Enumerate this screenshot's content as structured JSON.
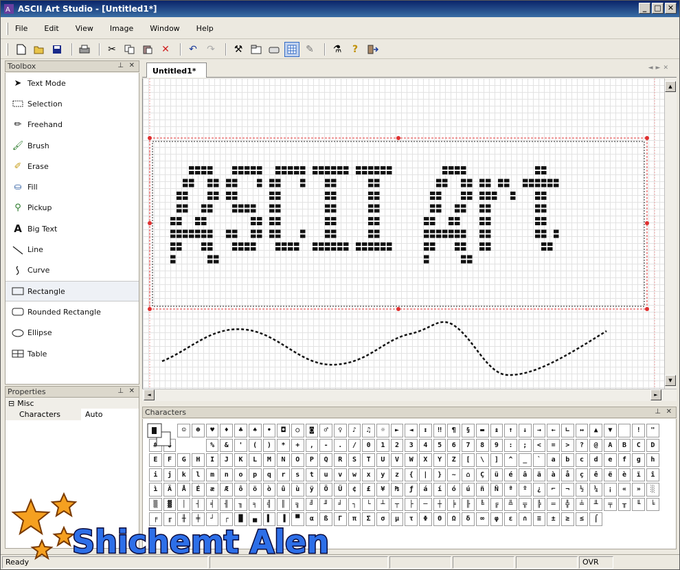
{
  "window": {
    "title": "ASCII Art Studio - [Untitled1*]",
    "buttons": [
      "_",
      "□",
      "✕"
    ]
  },
  "menu": [
    "File",
    "Edit",
    "View",
    "Image",
    "Window",
    "Help"
  ],
  "toolbar": {
    "icons": [
      "new-icon",
      "open-icon",
      "save-icon",
      "print-icon",
      "cut-icon",
      "copy-icon",
      "paste-icon",
      "delete-icon",
      "undo-icon",
      "redo-icon",
      "tools-icon",
      "properties-icon",
      "scanner-icon",
      "grid-icon",
      "pin-icon",
      "wand-icon",
      "help-icon",
      "exit-icon"
    ]
  },
  "toolbox": {
    "title": "Toolbox",
    "items": [
      {
        "label": "Text Mode",
        "icon": "arrow-icon"
      },
      {
        "label": "Selection",
        "icon": "selection-icon"
      },
      {
        "label": "Freehand",
        "icon": "pencil-icon"
      },
      {
        "label": "Brush",
        "icon": "brush-icon"
      },
      {
        "label": "Erase",
        "icon": "eraser-icon"
      },
      {
        "label": "Fill",
        "icon": "bucket-icon"
      },
      {
        "label": "Pickup",
        "icon": "dropper-icon"
      },
      {
        "label": "Big Text",
        "icon": "big-text-icon"
      },
      {
        "label": "Line",
        "icon": "line-icon"
      },
      {
        "label": "Curve",
        "icon": "curve-icon"
      },
      {
        "label": "Rectangle",
        "icon": "rectangle-icon"
      },
      {
        "label": "Rounded Rectangle",
        "icon": "rounded-rectangle-icon"
      },
      {
        "label": "Ellipse",
        "icon": "ellipse-icon"
      },
      {
        "label": "Table",
        "icon": "table-icon"
      }
    ],
    "selected": "Rectangle"
  },
  "properties": {
    "title": "Properties",
    "category": "Misc",
    "rows": [
      {
        "key": "Characters",
        "value": "Auto"
      }
    ]
  },
  "document": {
    "tab": "Untitled1*",
    "art_text": "ASCII Art"
  },
  "characters": {
    "title": "Characters",
    "rows": [
      [
        "",
        "",
        "☺",
        "☻",
        "♥",
        "♦",
        "♣",
        "♠",
        "•",
        "◘",
        "○",
        "◙",
        "♂",
        "♀",
        "♪",
        "♫",
        "☼",
        "►",
        "◄",
        "↕",
        "‼",
        "¶",
        "§",
        "▬",
        "↨",
        "↑",
        "↓",
        "→",
        "←",
        "∟",
        "↔",
        "▲",
        "▼",
        " ",
        "!",
        "\"",
        "#",
        "$"
      ],
      [
        "",
        "",
        "%",
        "&",
        "'",
        "(",
        ")",
        "*",
        "+",
        ",",
        "-",
        ".",
        "/",
        "0",
        "1",
        "2",
        "3",
        "4",
        "5",
        "6",
        "7",
        "8",
        "9",
        ":",
        ";",
        "<",
        "=",
        ">",
        "?",
        "@",
        "A",
        "B",
        "C",
        "D",
        "E"
      ],
      [
        "F",
        "G",
        "H",
        "I",
        "J",
        "K",
        "L",
        "M",
        "N",
        "O",
        "P",
        "Q",
        "R",
        "S",
        "T",
        "U",
        "V",
        "W",
        "X",
        "Y",
        "Z",
        "[",
        "\\",
        "]",
        "^",
        "_",
        "`",
        "a",
        "b",
        "c",
        "d",
        "e",
        "f",
        "g",
        "h"
      ],
      [
        "i",
        "j",
        "k",
        "l",
        "m",
        "n",
        "o",
        "p",
        "q",
        "r",
        "s",
        "t",
        "u",
        "v",
        "w",
        "x",
        "y",
        "z",
        "{",
        "|",
        "}",
        "~",
        "⌂",
        "Ç",
        "ü",
        "é",
        "â",
        "ä",
        "à",
        "å",
        "ç",
        "ê",
        "ë",
        "è",
        "ï"
      ],
      [
        "î",
        "ì",
        "Ä",
        "Å",
        "É",
        "æ",
        "Æ",
        "ô",
        "ö",
        "ò",
        "û",
        "ù",
        "ÿ",
        "Ö",
        "Ü",
        "¢",
        "£",
        "¥",
        "₧",
        "ƒ",
        "á",
        "í",
        "ó",
        "ú",
        "ñ",
        "Ñ",
        "ª",
        "º",
        "¿",
        "⌐",
        "¬",
        "½",
        "¼",
        "¡",
        "«"
      ],
      [
        "»",
        "░",
        "▒",
        "▓",
        "│",
        "┤",
        "╡",
        "╢",
        "╖",
        "╕",
        "╣",
        "║",
        "╗",
        "╝",
        "╜",
        "╛",
        "┐",
        "└",
        "┴",
        "┬",
        "├",
        "─",
        "┼",
        "╞",
        "╟",
        "╚",
        "╔",
        "╩",
        "╦",
        "╠",
        "═",
        "╬",
        "╧",
        "╨",
        "╤"
      ],
      [
        "╥",
        "╙",
        "╘",
        "╒",
        "╓",
        "╫",
        "╪",
        "┘",
        "┌",
        "█",
        "▄",
        "▌",
        "▐",
        "▀",
        "α",
        "ß",
        "Γ",
        "π",
        "Σ",
        "σ",
        "µ",
        "τ",
        "Φ",
        "Θ",
        "Ω",
        "δ",
        "∞",
        "φ",
        "ε",
        "∩",
        "≡",
        "±",
        "≥",
        "≤",
        "⌠"
      ]
    ]
  },
  "status": {
    "text": "Ready",
    "mode": "OVR"
  },
  "watermark": "Shichemt Alen",
  "colors": {
    "title_start": "#0a246a",
    "title_end": "#3a6ea5",
    "selection": "#e03030",
    "watermark_blue": "#2d6fe8"
  }
}
